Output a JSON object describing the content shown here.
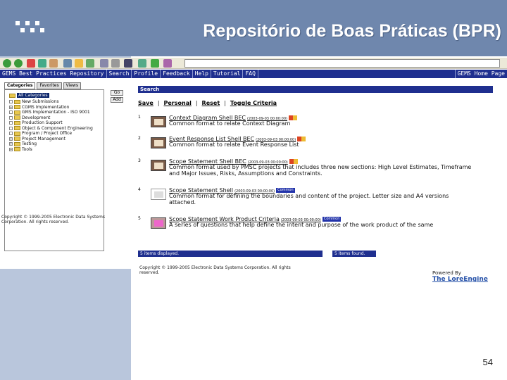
{
  "slide": {
    "title": "Repositório de Boas Práticas (BPR)",
    "page_number": "54"
  },
  "browser": {
    "nav": [
      "GEMS Best Practices Repository",
      "Search",
      "Profile",
      "Feedback",
      "Help",
      "Tutorial",
      "FAQ"
    ],
    "home": "GEMS Home Page"
  },
  "left_pane": {
    "tabs": [
      "Categories",
      "Favorites",
      "Views"
    ],
    "side_buttons": [
      "Go",
      "Add"
    ],
    "root_label": "All Categories",
    "tree": [
      {
        "label": "New Submissions",
        "expand": ""
      },
      {
        "label": "CGMS Implementation",
        "expand": "+"
      },
      {
        "label": "GMS Implementation - ISO 9001",
        "expand": ""
      },
      {
        "label": "Development",
        "expand": ""
      },
      {
        "label": "Production Support",
        "expand": ""
      },
      {
        "label": "Object & Component Engineering",
        "expand": ""
      },
      {
        "label": "Program / Project Office",
        "expand": ""
      },
      {
        "label": "Project Management",
        "expand": "+"
      },
      {
        "label": "Testing",
        "expand": "+"
      },
      {
        "label": "Tools",
        "expand": "+"
      }
    ],
    "copyright": "Copyright © 1999-2005 Electronic Data Systems Corporation. All rights reserved."
  },
  "main": {
    "header": "Search",
    "links": [
      "Save",
      "Personal",
      "Reset",
      "Toggle Criteria"
    ],
    "results": [
      {
        "num": "1",
        "title": "Context Diagram Shell BEC",
        "date": "(2003-09-03 00:00:00)",
        "desc": "Common format to relate Context Diagram",
        "tag": ""
      },
      {
        "num": "2",
        "title": "Event Response List Shell BEC",
        "date": "(2003-09-03 00:00:00)",
        "desc": "Common format to relate Event Response List",
        "tag": ""
      },
      {
        "num": "3",
        "title": "Scope Statement Shell BEC",
        "date": "(2003-09-03 00:00:00)",
        "desc": "Common format used by PMSC projects that includes three new sections: High Level Estimates, Timeframe and Major Issues, Risks, Assumptions and Constraints.",
        "tag": ""
      },
      {
        "num": "4",
        "title": "Scope Statement Shell",
        "date": "(2003-09-03 00:00:00)",
        "desc": "Common format for defining the boundaries and content of the project. Letter size and A4 versions attached.",
        "tag": "Common"
      },
      {
        "num": "5",
        "title": "Scope Statement Work Product Criteria",
        "date": "(2003-09-03 00:00:00)",
        "desc": "A series of questions that help define the intent and purpose of the work product of the same",
        "tag": "Common"
      }
    ],
    "status_left": "5 items displayed.",
    "status_right": "5 items found.",
    "copyright": "Copyright © 1999-2005 Electronic Data Systems Corporation. All rights reserved.",
    "powered_by": "Powered By",
    "brand": "The LoreEngine"
  },
  "colors": {
    "header_bg": "#6f87ad",
    "left_band": "#b9c6dc",
    "nav_bar": "#1f2f8f"
  }
}
